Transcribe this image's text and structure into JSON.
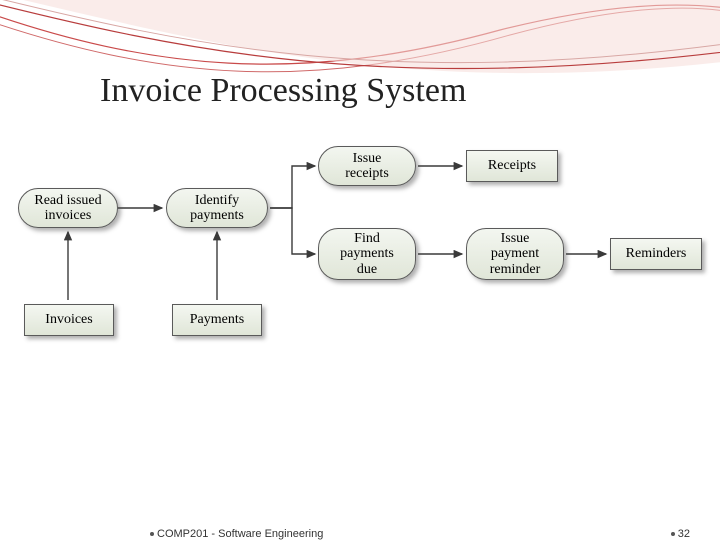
{
  "title": "Invoice Processing System",
  "nodes": {
    "read_issued": "Read issued\ninvoices",
    "identify_payments": "Identify\npayments",
    "issue_receipts": "Issue\nreceipts",
    "find_payments_due": "Find\npayments\ndue",
    "issue_reminder": "Issue\npayment\nreminder",
    "invoices": "Invoices",
    "payments": "Payments",
    "receipts": "Receipts",
    "reminders": "Reminders"
  },
  "footer": {
    "course": "COMP201 - Software Engineering",
    "page": "32"
  }
}
